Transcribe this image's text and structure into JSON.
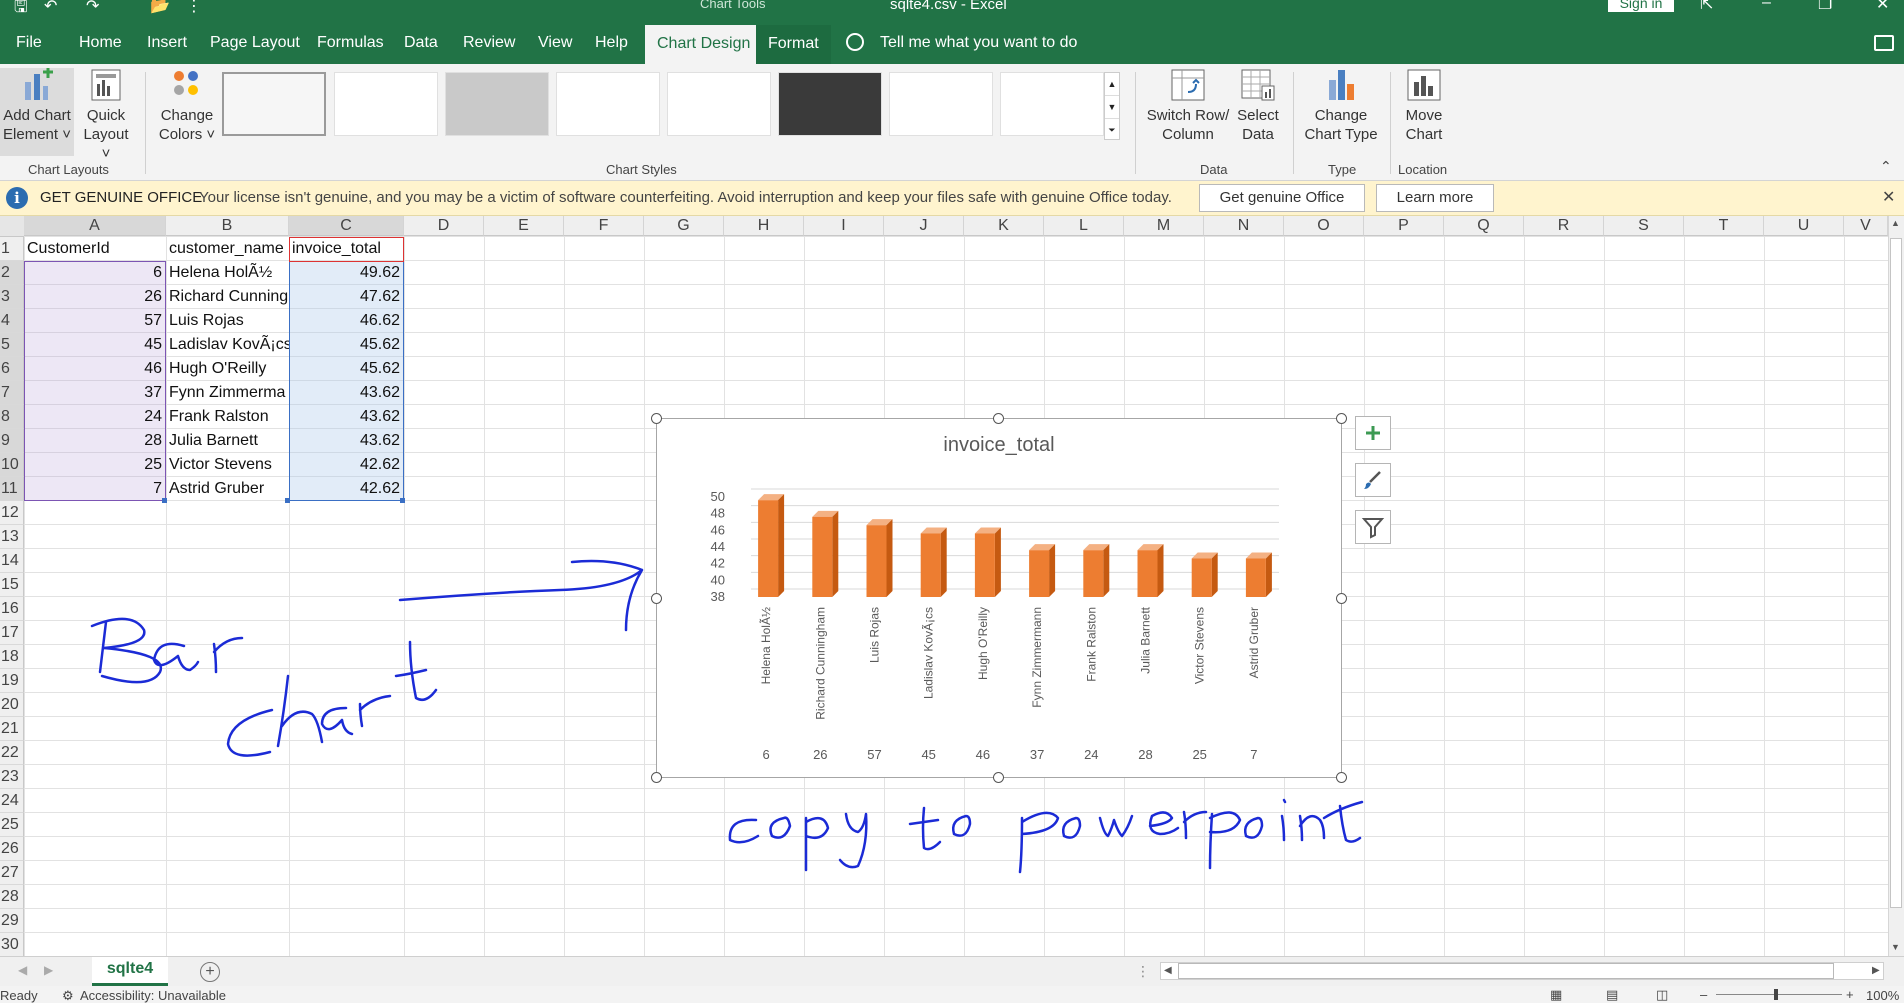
{
  "titlebar": {
    "context_label": "Chart Tools",
    "document_title": "sqlte4.csv  -  Excel",
    "signin_label": "Sign in"
  },
  "tabs": [
    "File",
    "Home",
    "Insert",
    "Page Layout",
    "Formulas",
    "Data",
    "Review",
    "View",
    "Help",
    "Chart Design",
    "Format"
  ],
  "tell_me": "Tell me what you want to do",
  "ribbon": {
    "add_chart_element": [
      "Add Chart",
      "Element ˅"
    ],
    "quick_layout": [
      "Quick",
      "Layout ˅"
    ],
    "change_colors": [
      "Change",
      "Colors ˅"
    ],
    "switch_row_column": [
      "Switch Row/",
      "Column"
    ],
    "select_data": [
      "Select",
      "Data"
    ],
    "change_chart_type": [
      "Change",
      "Chart Type"
    ],
    "move_chart": [
      "Move",
      "Chart"
    ],
    "groups": {
      "chart_layouts": "Chart Layouts",
      "chart_styles": "Chart Styles",
      "data": "Data",
      "type": "Type",
      "location": "Location"
    }
  },
  "infobar": {
    "title": "GET GENUINE OFFICE",
    "message": "Your license isn't genuine, and you may be a victim of software counterfeiting. Avoid interruption and keep your files safe with genuine Office today.",
    "button_primary": "Get genuine Office",
    "button_secondary": "Learn more"
  },
  "columns": [
    "A",
    "B",
    "C",
    "D",
    "E",
    "F",
    "G",
    "H",
    "I",
    "J",
    "K",
    "L",
    "M",
    "N",
    "O",
    "P",
    "Q",
    "R",
    "S",
    "T",
    "U",
    "V"
  ],
  "rows": [
    "1",
    "2",
    "3",
    "4",
    "5",
    "6",
    "7",
    "8",
    "9",
    "10",
    "11",
    "12",
    "13",
    "14",
    "15",
    "16",
    "17",
    "18",
    "19",
    "20",
    "21",
    "22",
    "23",
    "24",
    "25",
    "26",
    "27",
    "28",
    "29",
    "30"
  ],
  "sheet": {
    "header": [
      "CustomerId",
      "customer_name",
      "invoice_total"
    ],
    "data": [
      [
        "6",
        "Helena HolÃ½",
        "49.62"
      ],
      [
        "26",
        "Richard Cunning",
        "47.62"
      ],
      [
        "57",
        "Luis Rojas",
        "46.62"
      ],
      [
        "45",
        "Ladislav KovÃ¡cs",
        "45.62"
      ],
      [
        "46",
        "Hugh O'Reilly",
        "45.62"
      ],
      [
        "37",
        "Fynn Zimmerma",
        "43.62"
      ],
      [
        "24",
        "Frank Ralston",
        "43.62"
      ],
      [
        "28",
        "Julia Barnett",
        "43.62"
      ],
      [
        "25",
        "Victor Stevens",
        "42.62"
      ],
      [
        "7",
        "Astrid Gruber",
        "42.62"
      ]
    ]
  },
  "chart_data": {
    "type": "bar",
    "title": "invoice_total",
    "categories": [
      "Helena HolÃ½",
      "Richard Cunningham",
      "Luis Rojas",
      "Ladislav KovÃ¡cs",
      "Hugh O'Reilly",
      "Fynn Zimmermann",
      "Frank Ralston",
      "Julia Barnett",
      "Victor Stevens",
      "Astrid Gruber"
    ],
    "outer_categories": [
      "6",
      "26",
      "57",
      "45",
      "46",
      "37",
      "24",
      "28",
      "25",
      "7"
    ],
    "values": [
      49.62,
      47.62,
      46.62,
      45.62,
      45.62,
      43.62,
      43.62,
      43.62,
      42.62,
      42.62
    ],
    "ylim": [
      38,
      50
    ],
    "yticks": [
      "38",
      "40",
      "42",
      "44",
      "46",
      "48",
      "50"
    ],
    "grid": true,
    "bar_color": "#ed7d31"
  },
  "sheet_tab": "sqlte4",
  "status": {
    "ready": "Ready",
    "accessibility": "Accessibility: Unavailable",
    "zoom": "100%"
  },
  "handwriting": [
    "Bar",
    "Chart",
    "copy to PowerPoint"
  ]
}
